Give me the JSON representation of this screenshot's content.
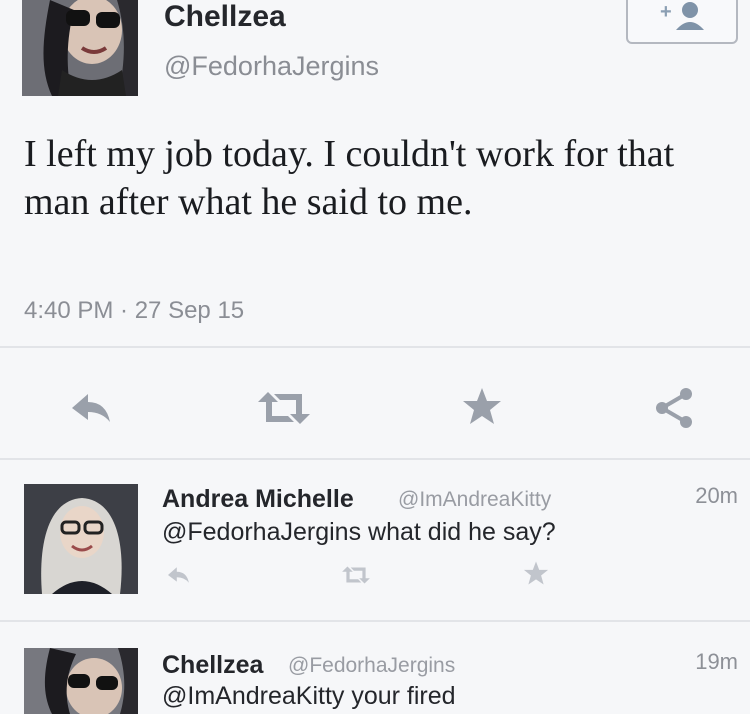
{
  "main_tweet": {
    "display_name": "Chellzea",
    "handle": "@FedorhaJergins",
    "text": "I left my job today. I couldn't work for that man after what he said to me.",
    "timestamp": "4:40 PM · 27 Sep 15",
    "actions": [
      "reply-icon",
      "retweet-icon",
      "favorite-star-icon",
      "share-icon"
    ],
    "follow_icon": "add-user-icon"
  },
  "replies": [
    {
      "display_name": "Andrea Michelle",
      "handle": "@ImAndreaKitty",
      "time": "20m",
      "text": "@FedorhaJergins what did he say?"
    },
    {
      "display_name": "Chellzea",
      "handle": "@FedorhaJergins",
      "time": "19m",
      "text": "@ImAndreaKitty your fired"
    }
  ],
  "colors": {
    "background": "#f6f7f9",
    "text": "#1b1d21",
    "muted": "#8a8d94",
    "icon": "#9aa0aa",
    "divider": "#e2e4e8"
  }
}
